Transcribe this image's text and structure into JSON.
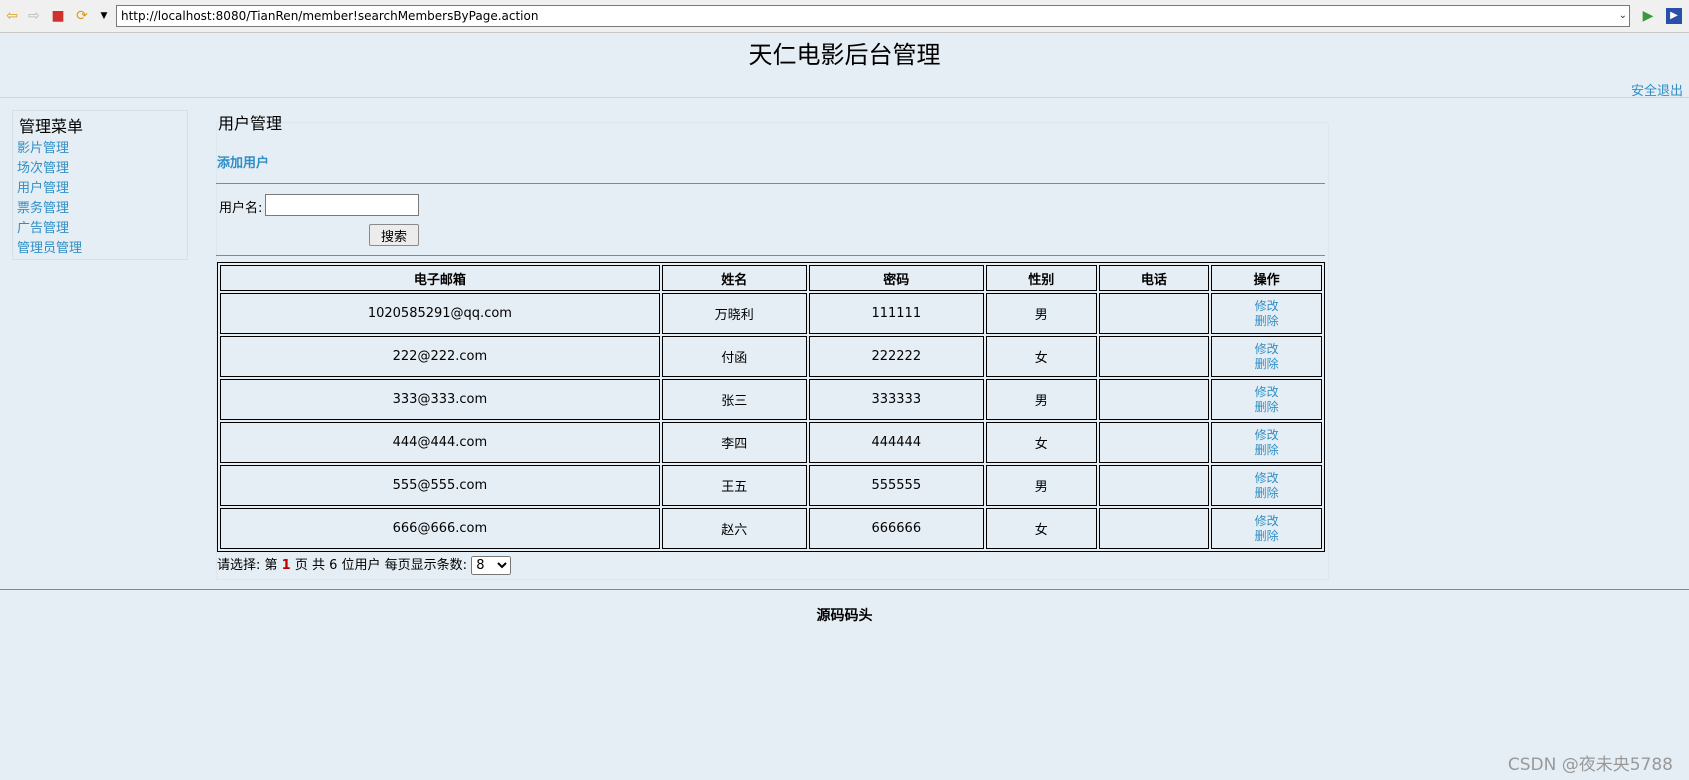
{
  "browser": {
    "url": "http://localhost:8080/TianRen/member!searchMembersByPage.action"
  },
  "header": {
    "title": "天仁电影后台管理",
    "logout": "安全退出"
  },
  "sidebar": {
    "title": "管理菜单",
    "items": [
      {
        "label": "影片管理"
      },
      {
        "label": "场次管理"
      },
      {
        "label": "用户管理"
      },
      {
        "label": "票务管理"
      },
      {
        "label": "广告管理"
      },
      {
        "label": "管理员管理"
      }
    ]
  },
  "main": {
    "title": "用户管理",
    "add_user": "添加用户",
    "search": {
      "label": "用户名:",
      "value": "",
      "button": "搜索"
    },
    "table": {
      "headers": [
        "电子邮箱",
        "姓名",
        "密码",
        "性别",
        "电话",
        "操作"
      ],
      "edit_label": "修改",
      "delete_label": "删除",
      "rows": [
        {
          "email": "1020585291@qq.com",
          "name": "万晓利",
          "password": "111111",
          "gender": "男",
          "phone": ""
        },
        {
          "email": "222@222.com",
          "name": "付函",
          "password": "222222",
          "gender": "女",
          "phone": ""
        },
        {
          "email": "333@333.com",
          "name": "张三",
          "password": "333333",
          "gender": "男",
          "phone": ""
        },
        {
          "email": "444@444.com",
          "name": "李四",
          "password": "444444",
          "gender": "女",
          "phone": ""
        },
        {
          "email": "555@555.com",
          "name": "王五",
          "password": "555555",
          "gender": "男",
          "phone": ""
        },
        {
          "email": "666@666.com",
          "name": "赵六",
          "password": "666666",
          "gender": "女",
          "phone": ""
        }
      ]
    },
    "pager": {
      "prefix": "请选择: 第",
      "current_page": "1",
      "middle": "页 共",
      "total_users": "6",
      "suffix": "位用户 每页显示条数:",
      "per_page": "8"
    }
  },
  "footer": {
    "text": "源码码头"
  },
  "watermark": "CSDN @夜未央5788"
}
